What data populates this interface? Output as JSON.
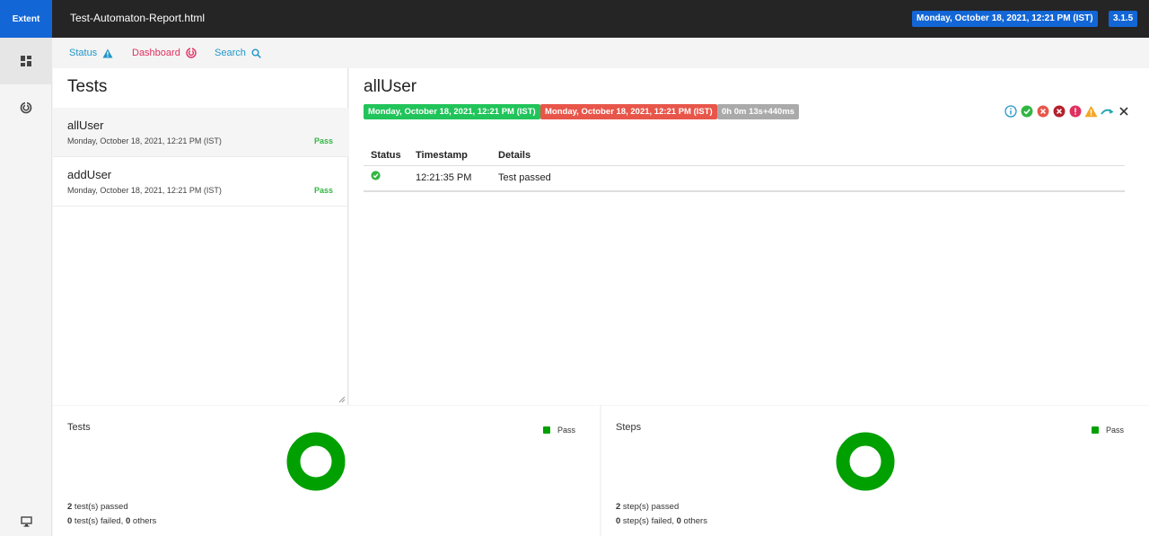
{
  "header": {
    "brand": "Extent",
    "title": "Test-Automaton-Report.html",
    "date": "Monday, October 18, 2021, 12:21 PM (IST)",
    "version": "3.1.5"
  },
  "rail": {
    "icons": [
      "dashboard-grid-icon",
      "spiral-chart-icon",
      "monitor-icon"
    ]
  },
  "subnav": {
    "items": [
      {
        "label": "Status",
        "icon": "warning-icon",
        "color": "#2196c9"
      },
      {
        "label": "Dashboard",
        "icon": "spiral-icon",
        "color": "#e0305f"
      },
      {
        "label": "Search",
        "icon": "search-icon",
        "color": "#2196c9"
      }
    ]
  },
  "tests": {
    "title": "Tests",
    "items": [
      {
        "name": "allUser",
        "time": "Monday, October 18, 2021, 12:21 PM (IST)",
        "status": "Pass"
      },
      {
        "name": "addUser",
        "time": "Monday, October 18, 2021, 12:21 PM (IST)",
        "status": "Pass"
      }
    ]
  },
  "detail": {
    "title": "allUser",
    "start": "Monday, October 18, 2021, 12:21 PM (IST)",
    "end": "Monday, October 18, 2021, 12:21 PM (IST)",
    "duration": "0h 0m 13s+440ms",
    "filters": [
      "info-icon",
      "pass-icon",
      "fail-icon",
      "fatal-icon",
      "error-icon",
      "warning-icon",
      "skip-icon",
      "close-icon"
    ],
    "columns": [
      "Status",
      "Timestamp",
      "Details"
    ],
    "rows": [
      {
        "status_icon": "pass-check-icon",
        "timestamp": "12:21:35 PM",
        "details": "Test passed"
      }
    ]
  },
  "charts": {
    "tests": {
      "title": "Tests",
      "legend": "Pass",
      "passed_count": "2",
      "passed_text": " test(s) passed",
      "failed_count": "0",
      "failed_text": " test(s) failed, ",
      "others_count": "0",
      "others_text": " others"
    },
    "steps": {
      "title": "Steps",
      "legend": "Pass",
      "passed_count": "2",
      "passed_text": " step(s) passed",
      "failed_count": "0",
      "failed_text": " step(s) failed, ",
      "others_count": "0",
      "others_text": " others"
    },
    "pass_color": "#00a000"
  }
}
